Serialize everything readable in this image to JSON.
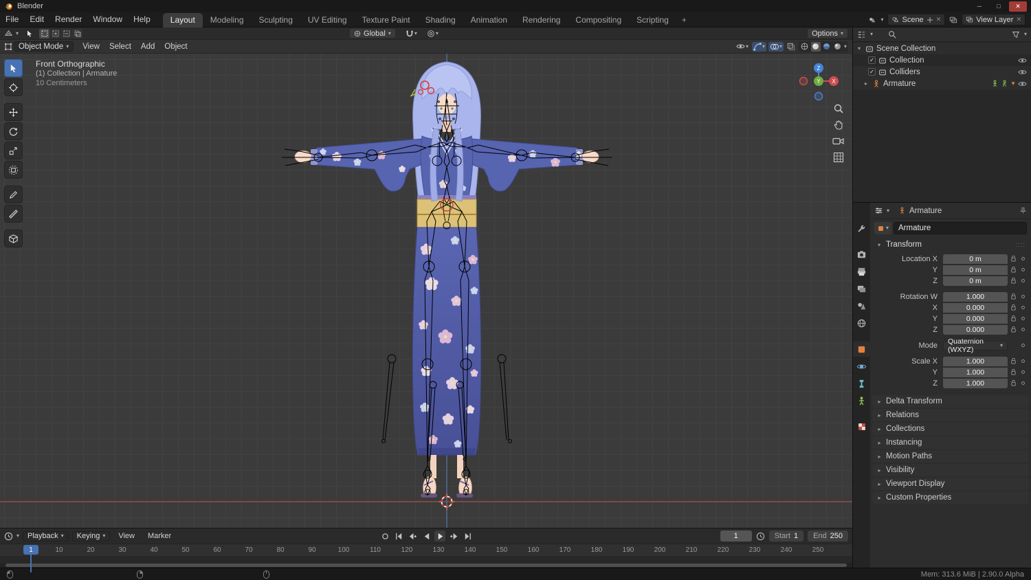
{
  "titlebar": {
    "app_title": "Blender",
    "window_controls": {
      "minimize": "─",
      "maximize": "□",
      "close": "✕"
    }
  },
  "topbar": {
    "menus": [
      {
        "label": "File"
      },
      {
        "label": "Edit"
      },
      {
        "label": "Render"
      },
      {
        "label": "Window"
      },
      {
        "label": "Help"
      }
    ],
    "workspaces": [
      {
        "label": "Layout"
      },
      {
        "label": "Modeling"
      },
      {
        "label": "Sculpting"
      },
      {
        "label": "UV Editing"
      },
      {
        "label": "Texture Paint"
      },
      {
        "label": "Shading"
      },
      {
        "label": "Animation"
      },
      {
        "label": "Rendering"
      },
      {
        "label": "Compositing"
      },
      {
        "label": "Scripting"
      }
    ],
    "active_workspace": "Layout",
    "add_workspace_label": "+",
    "scene_selector": {
      "value": "Scene"
    },
    "view_layer_selector": {
      "value": "View Layer"
    }
  },
  "viewport": {
    "tool_settings": {
      "orientation": "Global",
      "options_label": "Options"
    },
    "header": {
      "mode": "Object Mode",
      "menus": [
        {
          "label": "View"
        },
        {
          "label": "Select"
        },
        {
          "label": "Add"
        },
        {
          "label": "Object"
        }
      ]
    },
    "overlay_info": {
      "view_name": "Front Orthographic",
      "context": "(1) Collection | Armature",
      "grid_scale": "10 Centimeters"
    },
    "axis_gizmo": {
      "x": "X",
      "y": "Y",
      "z": "Z"
    },
    "tools": [
      "select-box",
      "cursor",
      "move",
      "rotate",
      "scale",
      "transform",
      "annotate",
      "measure",
      "add-cube"
    ]
  },
  "outliner": {
    "scene_collection": {
      "label": "Scene Collection"
    },
    "collections": [
      {
        "label": "Collection"
      },
      {
        "label": "Colliders"
      }
    ],
    "armature": {
      "label": "Armature"
    }
  },
  "properties": {
    "tabs": [
      "tool",
      "render",
      "output",
      "view-layer",
      "scene",
      "world",
      "object",
      "physics",
      "constraints",
      "data",
      "texture"
    ],
    "active_tab": "object",
    "breadcrumb": "Armature",
    "name_field": "Armature",
    "transform": {
      "title": "Transform",
      "location_rows": [
        {
          "label": "Location X",
          "value": "0 m"
        },
        {
          "label": "Y",
          "value": "0 m"
        },
        {
          "label": "Z",
          "value": "0 m"
        }
      ],
      "rotation_rows": [
        {
          "label": "Rotation W",
          "value": "1.000"
        },
        {
          "label": "X",
          "value": "0.000"
        },
        {
          "label": "Y",
          "value": "0.000"
        },
        {
          "label": "Z",
          "value": "0.000"
        }
      ],
      "mode_row": {
        "label": "Mode",
        "value": "Quaternion (WXYZ)"
      },
      "scale_rows": [
        {
          "label": "Scale X",
          "value": "1.000"
        },
        {
          "label": "Y",
          "value": "1.000"
        },
        {
          "label": "Z",
          "value": "1.000"
        }
      ]
    },
    "collapsed_sections": [
      {
        "label": "Delta Transform"
      },
      {
        "label": "Relations"
      },
      {
        "label": "Collections"
      },
      {
        "label": "Instancing"
      },
      {
        "label": "Motion Paths"
      },
      {
        "label": "Visibility"
      },
      {
        "label": "Viewport Display"
      },
      {
        "label": "Custom Properties"
      }
    ]
  },
  "timeline": {
    "menus": {
      "playback": "Playback",
      "keying": "Keying",
      "view": "View",
      "marker": "Marker"
    },
    "current_frame": "1",
    "playhead_frame": "1",
    "start": {
      "label": "Start",
      "value": "1"
    },
    "end": {
      "label": "End",
      "value": "250"
    },
    "ruler_ticks": [
      {
        "label": "10"
      },
      {
        "label": "20"
      },
      {
        "label": "30"
      },
      {
        "label": "40"
      },
      {
        "label": "50"
      },
      {
        "label": "60"
      },
      {
        "label": "70"
      },
      {
        "label": "80"
      },
      {
        "label": "90"
      },
      {
        "label": "100"
      },
      {
        "label": "110"
      },
      {
        "label": "120"
      },
      {
        "label": "130"
      },
      {
        "label": "140"
      },
      {
        "label": "150"
      },
      {
        "label": "160"
      },
      {
        "label": "170"
      },
      {
        "label": "180"
      },
      {
        "label": "190"
      },
      {
        "label": "200"
      },
      {
        "label": "210"
      },
      {
        "label": "220"
      },
      {
        "label": "230"
      },
      {
        "label": "240"
      },
      {
        "label": "250"
      }
    ]
  },
  "statusbar": {
    "memory_text": "Mem: 313.6 MiB | 2.90.0 Alpha"
  }
}
